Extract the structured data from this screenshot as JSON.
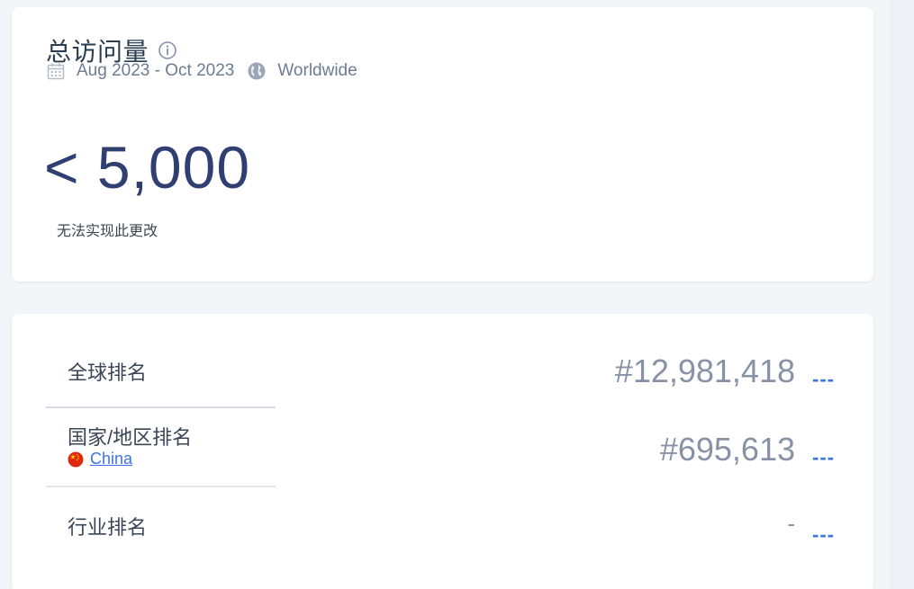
{
  "visits": {
    "title": "总访问量",
    "date_range": "Aug 2023 - Oct 2023",
    "region": "Worldwide",
    "value": "< 5,000",
    "note": "无法实现此更改"
  },
  "rankings": {
    "global": {
      "label": "全球排名",
      "value": "#12,981,418",
      "change": "---"
    },
    "country": {
      "label": "国家/地区排名",
      "country": "China",
      "value": "#695,613",
      "change": "---"
    },
    "industry": {
      "label": "行业排名",
      "value": "-",
      "change": "---"
    }
  },
  "icons": {
    "info": "info-icon",
    "calendar": "calendar-icon",
    "globe": "globe-icon",
    "flag": "china-flag-icon"
  },
  "colors": {
    "accent": "#3b74e0",
    "value_text": "#2f3f72",
    "flag_red": "#de2910",
    "flag_star": "#ffde00"
  }
}
